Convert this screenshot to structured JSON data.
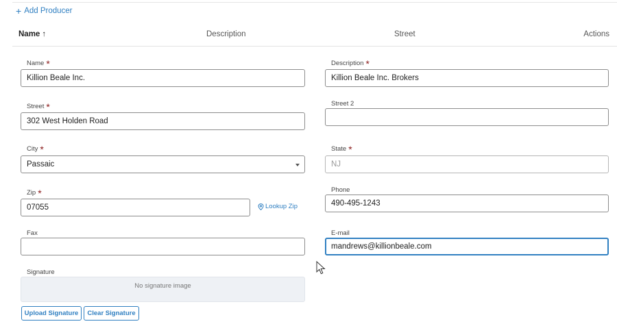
{
  "toolbar": {
    "add_label": "Add Producer"
  },
  "table_header": {
    "name": "Name",
    "sort_indicator": "↑",
    "description": "Description",
    "street": "Street",
    "actions": "Actions"
  },
  "form": {
    "name": {
      "label": "Name",
      "value": "Killion Beale Inc."
    },
    "description": {
      "label": "Description",
      "value": "Killion Beale Inc. Brokers"
    },
    "street": {
      "label": "Street",
      "value": "302 West Holden Road"
    },
    "street2": {
      "label": "Street 2",
      "value": ""
    },
    "city": {
      "label": "City",
      "value": "Passaic"
    },
    "state": {
      "label": "State",
      "placeholder": "NJ"
    },
    "zip": {
      "label": "Zip",
      "value": "07055"
    },
    "lookup_zip": "Lookup Zip",
    "phone": {
      "label": "Phone",
      "value": "490-495-1243"
    },
    "fax": {
      "label": "Fax",
      "value": ""
    },
    "email": {
      "label": "E-mail",
      "value": "mandrews@killionbeale.com"
    },
    "signature": {
      "label": "Signature",
      "empty_text": "No signature image"
    },
    "upload_signature": "Upload Signature",
    "clear_signature": "Clear Signature"
  },
  "required_marker": "*",
  "colors": {
    "accent": "#2f7fc1",
    "required": "#8a1a1a"
  }
}
